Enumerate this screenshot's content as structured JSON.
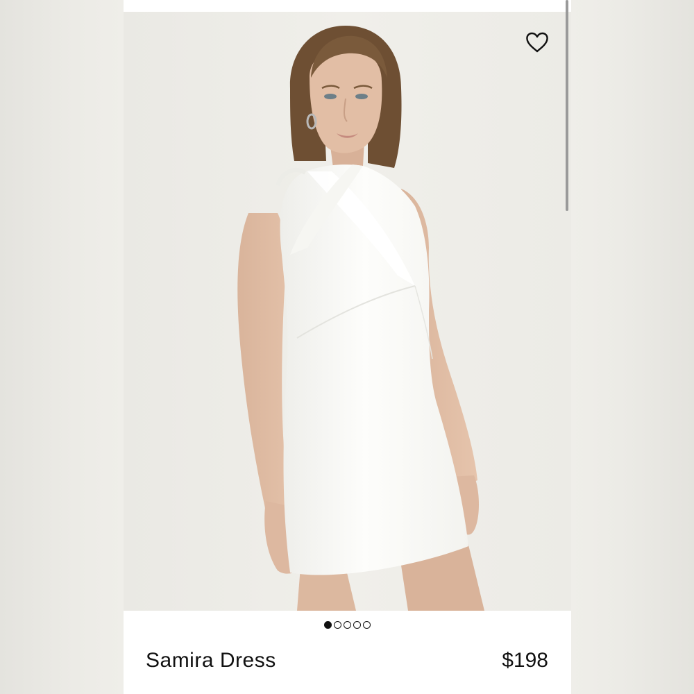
{
  "product": {
    "name": "Samira Dress",
    "price": "$198"
  },
  "gallery": {
    "image_count": 5,
    "active_index": 0,
    "photo_background": "#eeede8"
  },
  "icons": {
    "favorite": "heart-outline-icon"
  },
  "colors": {
    "text": "#111111",
    "screen_background": "#ffffff",
    "dress": "#fbfbf9",
    "hair": "#6e4f33"
  }
}
